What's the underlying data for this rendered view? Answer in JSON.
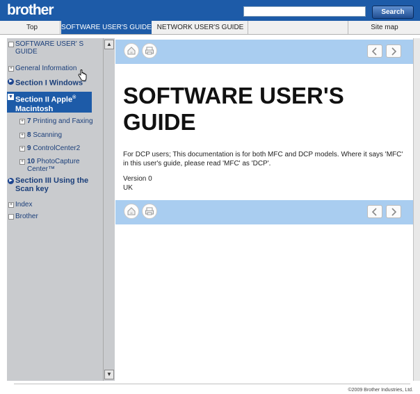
{
  "header": {
    "logo": "brother",
    "search_placeholder": "",
    "search_button": "Search"
  },
  "tabs": {
    "top": "Top",
    "software": "SOFTWARE USER'S GUIDE",
    "network": "NETWORK USER'S GUIDE",
    "sitemap": "Site map"
  },
  "sidebar": {
    "guide": "SOFTWARE USER' S GUIDE",
    "general": "General Information",
    "section1": "Section I Windows",
    "section1_sup": "®",
    "section2_line1": "Section II Apple",
    "section2_sup": "®",
    "section2_line2": "Macintosh",
    "ch7_num": "7",
    "ch7": "Printing and Faxing",
    "ch8_num": "8",
    "ch8": "Scanning",
    "ch9_num": "9",
    "ch9": "ControlCenter2",
    "ch10_num": "10",
    "ch10": "PhotoCapture Center™",
    "section3": "Section III Using the Scan key",
    "index": "Index",
    "brother": "Brother"
  },
  "main": {
    "title": "SOFTWARE USER'S GUIDE",
    "description": "For DCP users; This documentation is for both MFC and DCP models. Where it says 'MFC' in this user's guide, please read 'MFC' as 'DCP'.",
    "version": "Version 0",
    "region": "UK"
  },
  "footer": {
    "copyright": "©2009 Brother Industries, Ltd."
  },
  "colors": {
    "brand_blue": "#1d5ba8",
    "band_blue": "#a9cdf0",
    "sidebar_gray": "#c9cbce"
  },
  "icons": [
    "home-icon",
    "print-icon",
    "prev-arrow-icon",
    "next-arrow-icon",
    "hand-cursor-icon"
  ]
}
